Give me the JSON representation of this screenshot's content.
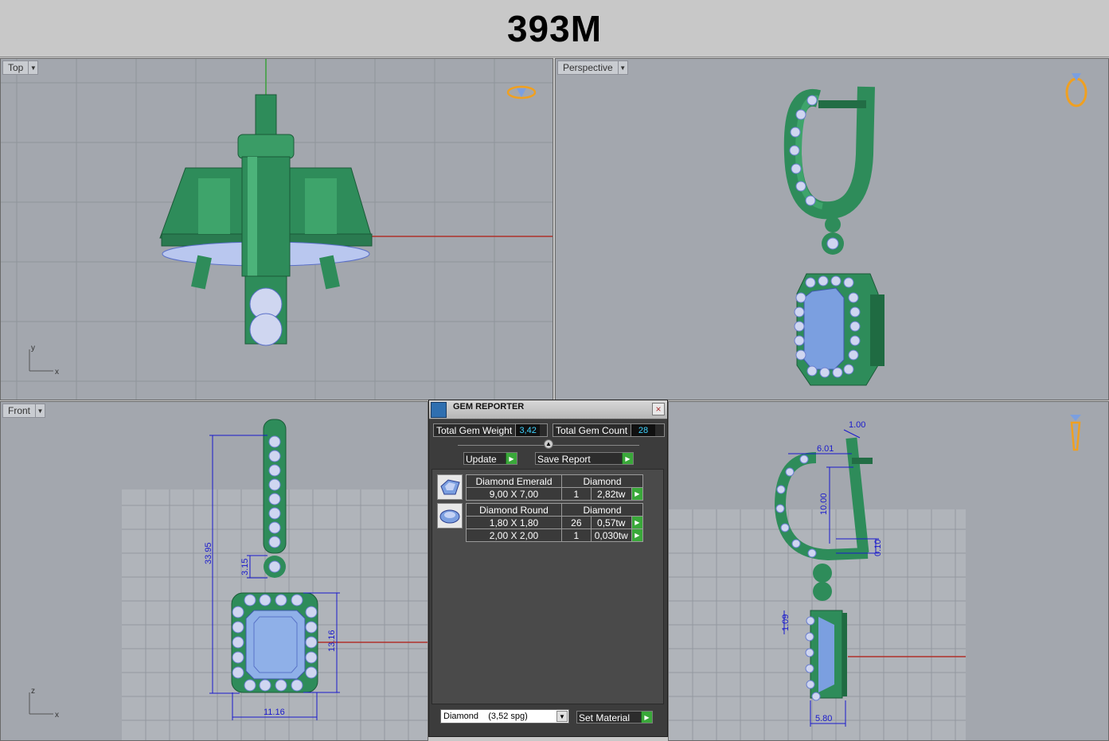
{
  "header": {
    "title": "393M"
  },
  "viewports": {
    "top": {
      "label": "Top",
      "axis_x": "x",
      "axis_y": "y"
    },
    "perspective": {
      "label": "Perspective"
    },
    "front": {
      "label": "Front",
      "axis_x": "x",
      "axis_z": "z",
      "dims": {
        "height_total": "33.95",
        "loop": "3.15",
        "stone_height": "13.16",
        "stone_width": "11.16"
      }
    },
    "right": {
      "dims": {
        "top_thickness": "1.00",
        "hook_width": "6.01",
        "hook_height": "10.00",
        "gap": "0.10",
        "stone_depth": "1.09",
        "bottom_width": "5.80"
      }
    }
  },
  "gem_reporter": {
    "title": "GEM REPORTER",
    "close": "×",
    "total_weight_label": "Total Gem Weight",
    "total_weight": "3,42",
    "total_count_label": "Total Gem Count",
    "total_count": "28",
    "update_label": "Update",
    "save_label": "Save Report",
    "groups": [
      {
        "name": "Diamond Emerald",
        "material": "Diamond",
        "icon": "emerald-cut-gem-icon",
        "rows": [
          {
            "size": "9,00 X 7,00",
            "count": "1",
            "weight": "2,82tw"
          }
        ]
      },
      {
        "name": "Diamond Round",
        "material": "Diamond",
        "icon": "round-gem-icon",
        "rows": [
          {
            "size": "1,80 X 1,80",
            "count": "26",
            "weight": "0,57tw"
          },
          {
            "size": "2,00 X 2,00",
            "count": "1",
            "weight": "0,030tw"
          }
        ]
      }
    ],
    "material_select": "Diamond    (3,52 spg)",
    "set_material_label": "Set Material"
  },
  "colors": {
    "metal": "#2e8c5a",
    "gem": "#7b9fe0",
    "dim": "#1a1acc",
    "background": "#a3a7ae",
    "accent_green": "#3aa83a"
  }
}
